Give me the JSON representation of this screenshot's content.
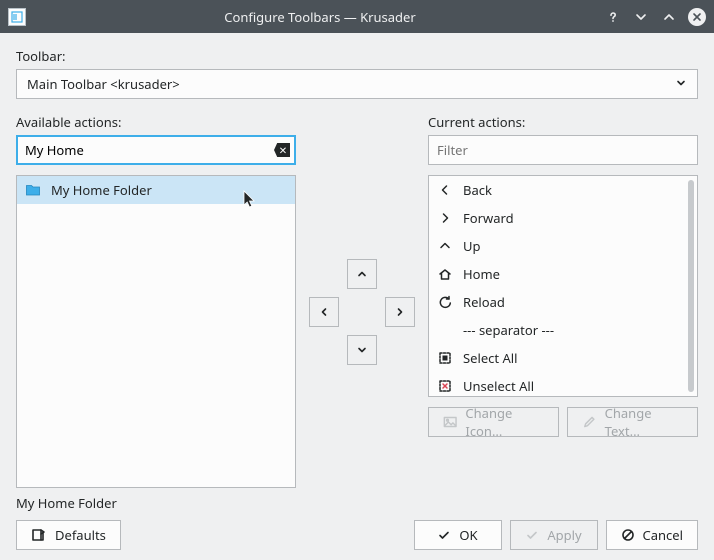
{
  "title": "Configure Toolbars — Krusader",
  "labels": {
    "toolbar": "Toolbar:",
    "available": "Available actions:",
    "current": "Current actions:"
  },
  "toolbar_select": {
    "value": "Main Toolbar <krusader>"
  },
  "available_filter": {
    "value": "My Home"
  },
  "current_filter": {
    "placeholder": "Filter",
    "value": ""
  },
  "available_list": [
    {
      "icon": "folder",
      "label": "My Home Folder",
      "selected": true
    }
  ],
  "current_list": [
    {
      "icon": "chev-left",
      "label": "Back"
    },
    {
      "icon": "chev-right",
      "label": "Forward"
    },
    {
      "icon": "chev-up",
      "label": "Up"
    },
    {
      "icon": "home",
      "label": "Home"
    },
    {
      "icon": "reload",
      "label": "Reload"
    },
    {
      "icon": "",
      "label": "--- separator ---"
    },
    {
      "icon": "select-all",
      "label": "Select All"
    },
    {
      "icon": "unselect-all",
      "label": "Unselect All"
    }
  ],
  "buttons": {
    "change_icon": "Change Icon...",
    "change_text": "Change Text...",
    "defaults": "Defaults",
    "ok": "OK",
    "apply": "Apply",
    "cancel": "Cancel"
  },
  "status_text": "My Home Folder"
}
